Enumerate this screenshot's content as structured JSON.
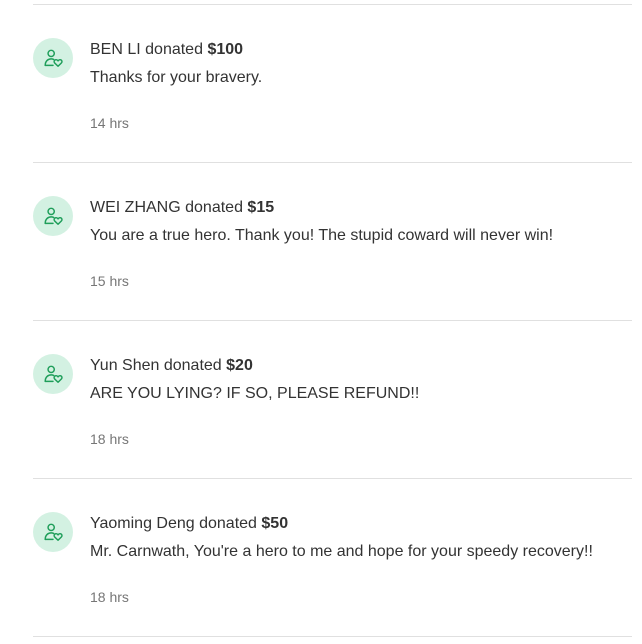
{
  "colors": {
    "avatar_bg": "#d3f1e2",
    "avatar_icon": "#1f9e5a",
    "divider": "#e0e0e0",
    "text": "#333333",
    "muted": "#767676"
  },
  "donations": [
    {
      "icon": "user-heart-icon",
      "donor": "BEN LI",
      "verb": "donated",
      "amount": "$100",
      "message": "Thanks for your bravery.",
      "time": "14 hrs"
    },
    {
      "icon": "user-heart-icon",
      "donor": "WEI ZHANG",
      "verb": "donated",
      "amount": "$15",
      "message": "You are a true hero. Thank you! The stupid coward will never win!",
      "time": "15 hrs"
    },
    {
      "icon": "user-heart-icon",
      "donor": "Yun Shen",
      "verb": "donated",
      "amount": "$20",
      "message": "ARE YOU LYING? IF SO, PLEASE REFUND!!",
      "time": "18 hrs"
    },
    {
      "icon": "user-heart-icon",
      "donor": "Yaoming Deng",
      "verb": "donated",
      "amount": "$50",
      "message": "Mr. Carnwath, You're a hero to me and hope for your speedy recovery!!",
      "time": "18 hrs"
    }
  ]
}
